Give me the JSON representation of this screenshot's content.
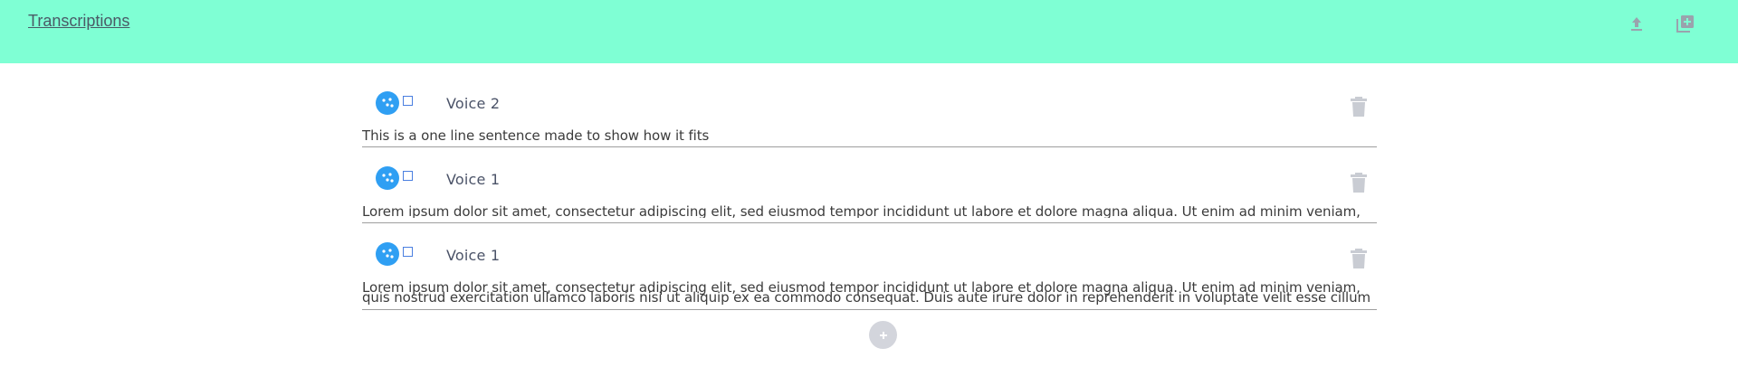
{
  "header": {
    "title": "Transcriptions",
    "upload_icon": "upload-icon",
    "add_icon": "library-add-icon",
    "background_color": "#7fffd4"
  },
  "transcriptions": [
    {
      "voice": "Voice 2",
      "text_lines": [
        "This is a one line sentence made to show how it fits"
      ]
    },
    {
      "voice": "Voice 1",
      "text_lines": [
        "Lorem ipsum dolor sit amet, consectetur adipiscing elit, sed eiusmod tempor incididunt ut labore et dolore magna aliqua. Ut enim ad minim veniam,"
      ]
    },
    {
      "voice": "Voice 1",
      "text_lines": [
        "Lorem ipsum dolor sit amet, consectetur adipiscing elit, sed eiusmod tempor incididunt ut labore et dolore magna aliqua. Ut enim ad minim veniam,",
        "quis nostrud exercitation ullamco laboris nisi ut aliquip ex ea commodo consequat. Duis aute irure dolor in reprehenderit in voluptate velit esse cillum"
      ]
    }
  ],
  "add_button_icon": "plus-icon",
  "colors": {
    "accent": "#2f9ff3",
    "muted": "#bfc3cc"
  }
}
